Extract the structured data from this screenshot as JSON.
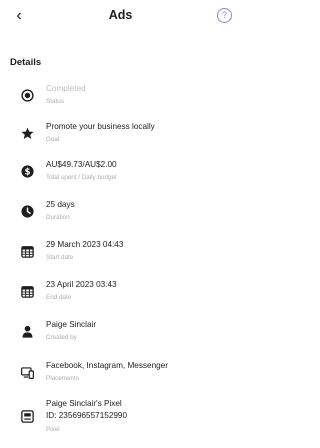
{
  "header": {
    "title": "Ads",
    "back_icon": "chevron-left-icon",
    "help_icon": "question-icon",
    "help_glyph": "?"
  },
  "section_title": "Details",
  "details": [
    {
      "icon": "status-radio-icon",
      "primary": "Completed",
      "secondary": "Status"
    },
    {
      "icon": "star-icon",
      "primary": "Promote your business locally",
      "secondary": "Goal"
    },
    {
      "icon": "dollar-icon",
      "primary": "AU$49.73/AU$2.00",
      "secondary": "Total spent / Daily budget"
    },
    {
      "icon": "clock-icon",
      "primary": "25 days",
      "secondary": "Duration"
    },
    {
      "icon": "calendar-icon",
      "primary": "29 March 2023 04:43",
      "secondary": "Start date"
    },
    {
      "icon": "calendar-icon",
      "primary": "23 April 2023 03:43",
      "secondary": "End date"
    },
    {
      "icon": "person-icon",
      "primary": "Paige Sinclair",
      "secondary": "Created by"
    },
    {
      "icon": "devices-icon",
      "primary": "Facebook, Instagram, Messenger",
      "secondary": "Placements"
    },
    {
      "icon": "pixel-icon",
      "primary": "Paige Sinclair's Pixel",
      "primary2": "ID: 235696557152990",
      "secondary": "Pixel"
    }
  ],
  "colors": {
    "accent": "#9b7bd8",
    "text": "#1c1e21",
    "muted": "#a9adb3",
    "faded": "#b8bcc2"
  }
}
